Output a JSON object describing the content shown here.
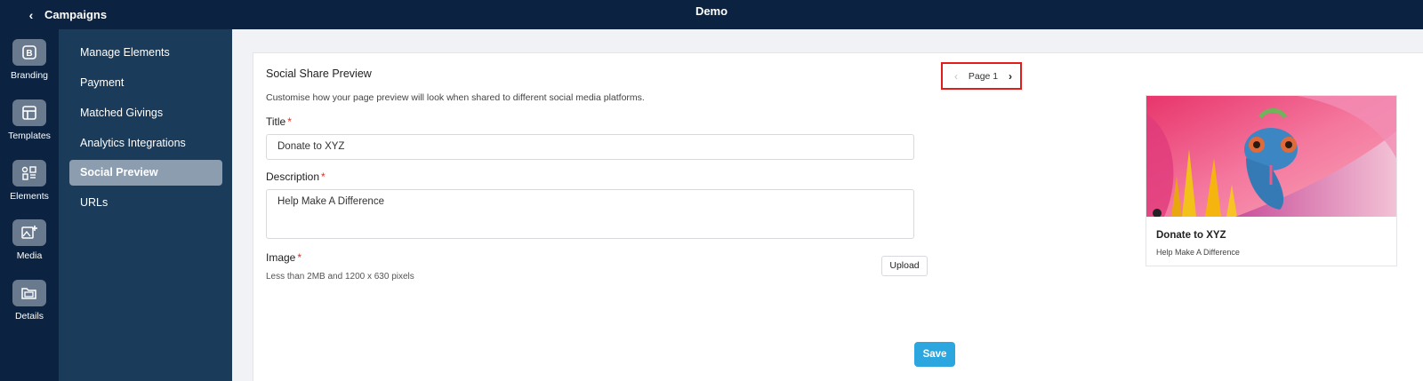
{
  "topbar": {
    "back_label": "Campaigns",
    "title": "Demo"
  },
  "rail": {
    "items": [
      {
        "label": "Branding",
        "icon": "branding-icon"
      },
      {
        "label": "Templates",
        "icon": "templates-icon"
      },
      {
        "label": "Elements",
        "icon": "elements-icon"
      },
      {
        "label": "Media",
        "icon": "media-icon"
      },
      {
        "label": "Details",
        "icon": "details-icon"
      }
    ]
  },
  "sidebar": {
    "items": [
      {
        "label": "Manage Elements"
      },
      {
        "label": "Payment"
      },
      {
        "label": "Matched Givings"
      },
      {
        "label": "Analytics Integrations"
      },
      {
        "label": "Social Preview",
        "active": true
      },
      {
        "label": "URLs"
      }
    ]
  },
  "main": {
    "section_title": "Social Share Preview",
    "section_description": "Customise how your page preview will look when shared to different social media platforms.",
    "title_label": "Title",
    "title_value": "Donate to XYZ",
    "description_label": "Description",
    "description_value": "Help Make A Difference",
    "image_label": "Image",
    "image_hint": "Less than 2MB and 1200 x 630 pixels",
    "upload_label": "Upload",
    "required_marker": "*",
    "save_label": "Save"
  },
  "pager": {
    "label": "Page 1",
    "prev_icon": "chevron-left-icon",
    "next_icon": "chevron-right-icon"
  },
  "preview": {
    "title": "Donate to XYZ",
    "description": "Help Make A Difference"
  },
  "colors": {
    "topbar_bg": "#0b2340",
    "subnav_bg": "#1b3b5a",
    "active_item_bg": "#8d9db0",
    "save_button": "#2ba6df",
    "highlight_border": "#e21b1b",
    "required": "#d93025"
  }
}
